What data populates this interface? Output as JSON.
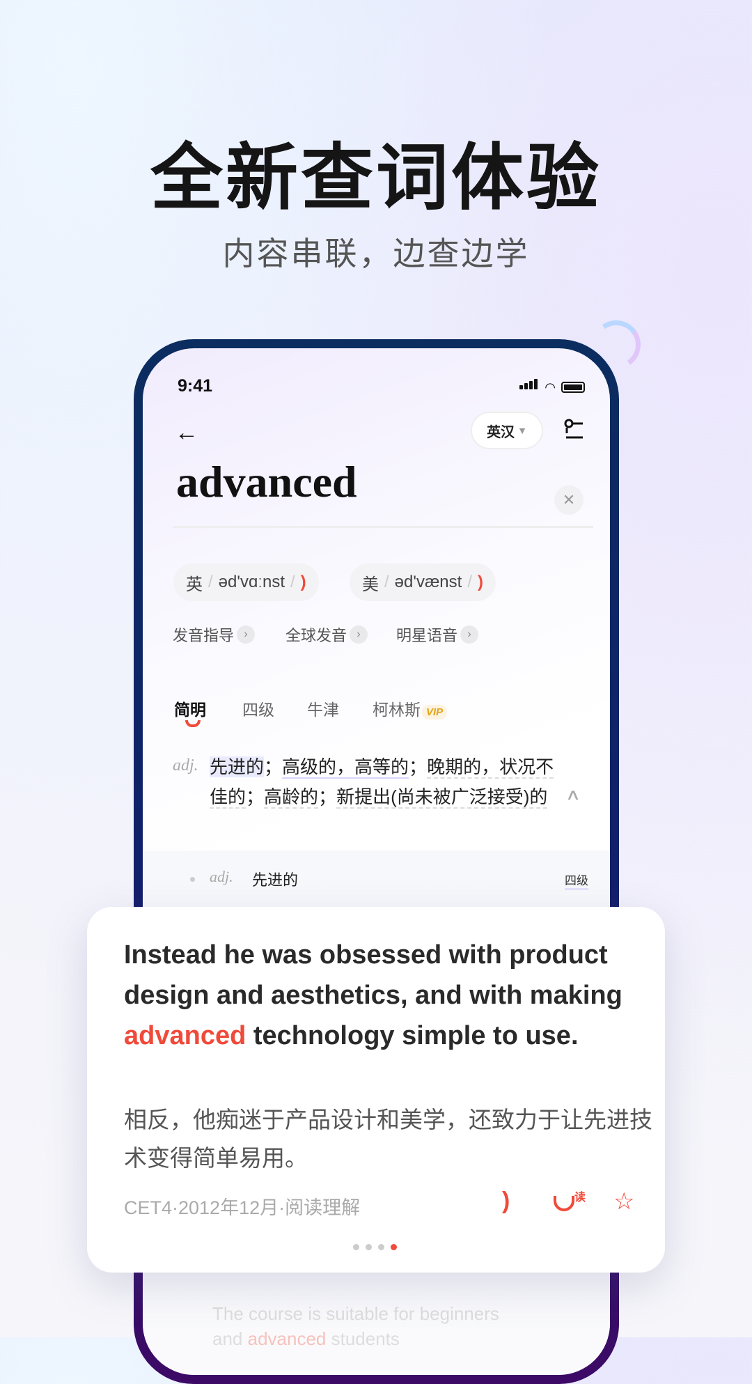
{
  "header": {
    "title": "全新查词体验",
    "subtitle": "内容串联，边查边学"
  },
  "status": {
    "time": "9:41"
  },
  "toolbar": {
    "lang": "英汉"
  },
  "search": {
    "word": "advanced"
  },
  "phonetics": [
    {
      "region": "英",
      "ipa": "əd'vɑːnst"
    },
    {
      "region": "美",
      "ipa": "əd'vænst"
    }
  ],
  "links": [
    "发音指导",
    "全球发音",
    "明星语音"
  ],
  "tabs": [
    "简明",
    "四级",
    "牛津",
    "柯林斯"
  ],
  "vip_badge": "VIP",
  "definition": {
    "pos": "adj.",
    "parts": [
      "先进的",
      "；",
      "高级的，高等的",
      "；",
      "晚期的，状况不佳的",
      "；",
      "高龄的",
      "；",
      "新提出(尚未被广泛接受)的"
    ]
  },
  "sub_item": {
    "pos": "adj.",
    "meaning": "先进的",
    "tag": "四级"
  },
  "card": {
    "en_before": "Instead he was obsessed with product design and aesthetics, and with making ",
    "en_highlight": "advanced",
    "en_after": " technology simple to use.",
    "zh": "相反，他痴迷于产品设计和美学，还致力于让先进技术变得简单易用。",
    "source": "CET4·2012年12月·阅读理解",
    "read_label": "读",
    "pages": 4,
    "current_page": 4
  },
  "faded_example": {
    "before": "The course is suitable for beginners and ",
    "highlight": "advanced",
    "after": " students"
  },
  "colors": {
    "accent": "#f04a3a",
    "phone_frame": "#0b2d5f"
  }
}
